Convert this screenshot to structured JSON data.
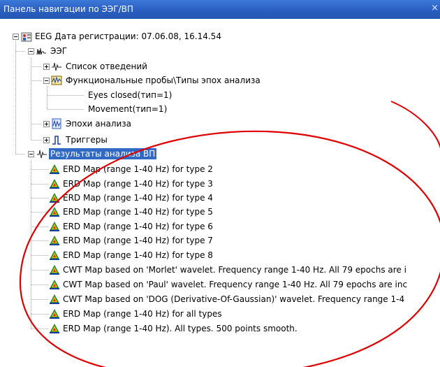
{
  "window": {
    "title": "Панель навигации по ЭЭГ/ВП",
    "close_glyph": "×"
  },
  "tree": {
    "root": "EEG Дата регистрации: 07.06.08, 16.14.54",
    "eeg": "ЭЭГ",
    "leads": "Список отведений",
    "tests": "Функциональные пробы\\Типы эпох анализа",
    "eyes_closed": "Eyes closed(тип=1)",
    "movement": "Movement(тип=1)",
    "epochs": "Эпохи анализа",
    "triggers": "Триггеры",
    "results": "Результаты анализа ВП",
    "result_items": [
      "ERD Map (range 1-40 Hz) for type 2",
      "ERD Map (range 1-40 Hz) for type 3",
      "ERD Map (range 1-40 Hz) for type 4",
      "ERD Map (range 1-40 Hz) for type 5",
      "ERD Map (range 1-40 Hz) for type 6",
      "ERD Map (range 1-40 Hz) for type 7",
      "ERD Map (range 1-40 Hz) for type 8",
      "CWT Map based on 'Morlet' wavelet. Frequency range 1-40 Hz. All 79 epochs are i",
      "CWT Map based on 'Paul' wavelet. Frequency range 1-40 Hz. All 79 epochs are inc",
      "CWT Map based on 'DOG (Derivative-Of-Gaussian)' wavelet. Frequency range 1-4",
      "ERD Map (range 1-40 Hz) for all types",
      "ERD Map (range 1-40 Hz). All types. 500 points smooth."
    ]
  },
  "icons": {
    "root": "patient-record-icon",
    "eeg": "eeg-wave-icon",
    "leads": "signal-trace-icon",
    "tests": "epoch-types-icon",
    "epochs": "epochs-icon",
    "triggers": "trigger-icon",
    "results": "signal-trace-icon",
    "result_item": "topographic-map-icon"
  },
  "colors": {
    "titlebar": "#2a5fc0",
    "selection": "#316ac5",
    "annotation": "#e00000"
  }
}
